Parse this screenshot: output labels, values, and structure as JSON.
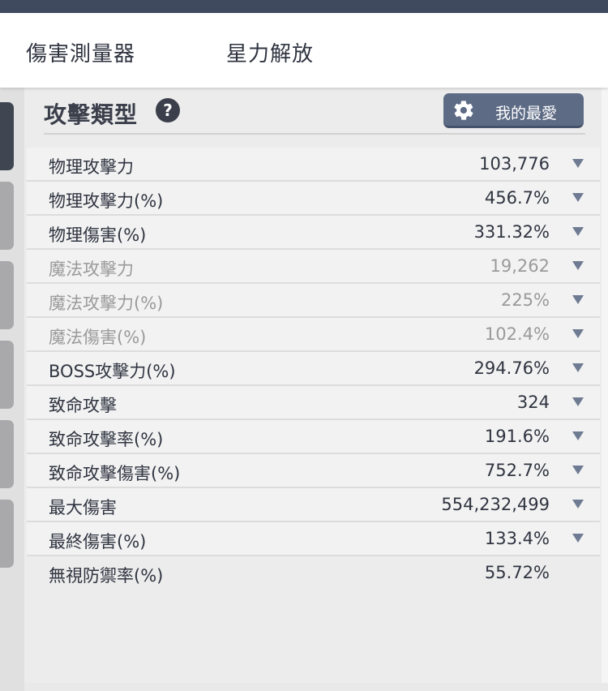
{
  "nav": {
    "damage_meter": "傷害測量器",
    "star_release": "星力解放"
  },
  "section": {
    "title": "攻擊類型",
    "help_icon": "?",
    "favorite_label": "我的最愛",
    "favorite_icon": "gear-icon"
  },
  "colors": {
    "topbar": "#404a5e",
    "button": "#5d6b85",
    "arrow": "#6f7b92",
    "dim_text": "#9a9a9a"
  },
  "stats": [
    {
      "label": "物理攻擊力",
      "value": "103,776",
      "dim": false
    },
    {
      "label": "物理攻擊力(%)",
      "value": "456.7%",
      "dim": false
    },
    {
      "label": "物理傷害(%)",
      "value": "331.32%",
      "dim": false
    },
    {
      "label": "魔法攻擊力",
      "value": "19,262",
      "dim": true
    },
    {
      "label": "魔法攻擊力(%)",
      "value": "225%",
      "dim": true
    },
    {
      "label": "魔法傷害(%)",
      "value": "102.4%",
      "dim": true
    },
    {
      "label": "BOSS攻擊力(%)",
      "value": "294.76%",
      "dim": false
    },
    {
      "label": "致命攻擊",
      "value": "324",
      "dim": false
    },
    {
      "label": "致命攻擊率(%)",
      "value": "191.6%",
      "dim": false
    },
    {
      "label": "致命攻擊傷害(%)",
      "value": "752.7%",
      "dim": false
    },
    {
      "label": "最大傷害",
      "value": "554,232,499",
      "dim": false
    },
    {
      "label": "最終傷害(%)",
      "value": "133.4%",
      "dim": false
    },
    {
      "label": "無視防禦率(%)",
      "value": "55.72%",
      "dim": false
    }
  ]
}
